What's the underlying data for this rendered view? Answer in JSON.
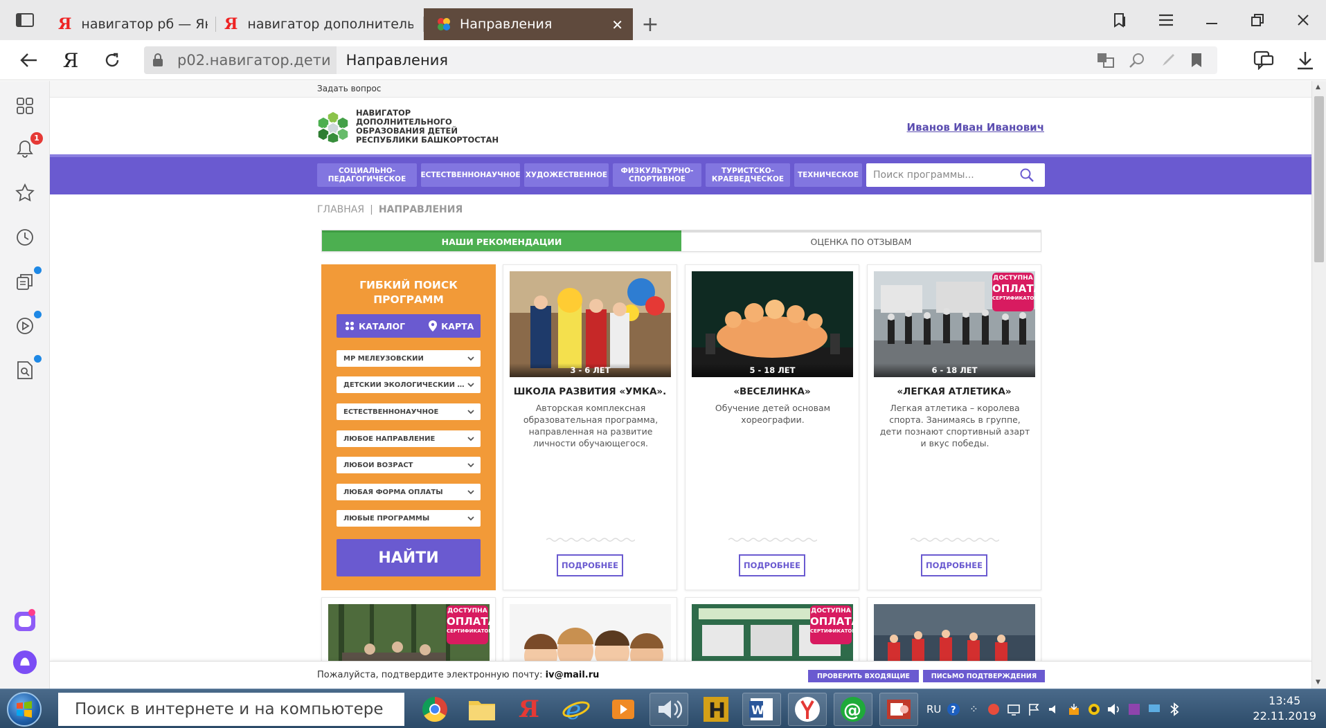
{
  "browser": {
    "tabs": [
      {
        "label": "навигатор рб — Яндекс: на"
      },
      {
        "label": "навигатор дополнительного"
      },
      {
        "label": "Направления"
      }
    ],
    "address": {
      "domain": "p02.навигатор.дети",
      "title": "Направления"
    },
    "sidebar_notification_count": "1"
  },
  "site": {
    "ask_question": "Задать вопрос",
    "logo_text": "НАВИГАТОР ДОПОЛНИТЕЛЬНОГО ОБРАЗОВАНИЯ ДЕТЕЙ РЕСПУБЛИКИ БАШКОРТОСТАН",
    "user_name": "Иванов Иван Иванович",
    "menu": [
      {
        "label": "СОЦИАЛЬНО-ПЕДАГОГИЧЕСКОЕ"
      },
      {
        "label": "ЕСТЕСТВЕННОНАУЧНОЕ"
      },
      {
        "label": "ХУДОЖЕСТВЕННОЕ"
      },
      {
        "label": "ФИЗКУЛЬТУРНО-СПОРТИВНОЕ"
      },
      {
        "label": "ТУРИСТСКО-КРАЕВЕДЧЕСКОЕ"
      },
      {
        "label": "ТЕХНИЧЕСКОЕ"
      }
    ],
    "search_placeholder": "Поиск программы...",
    "breadcrumb": {
      "home": "ГЛАВНАЯ",
      "sep": "|",
      "current": "НАПРАВЛЕНИЯ"
    },
    "rec_tabs": {
      "active": "НАШИ РЕКОМЕНДАЦИИ",
      "inactive": "ОЦЕНКА ПО ОТЗЫВАМ"
    },
    "filter": {
      "title": "ГИБКИЙ ПОИСК ПРОГРАММ",
      "catalog": "КАТАЛОГ",
      "map": "КАРТА",
      "selects": [
        "МР МЕЛЕУЗОВСКИЙ",
        "ДЕТСКИЙ ЭКОЛОГИЧЕСКИЙ ЦЕНТР",
        "ЕСТЕСТВЕННОНАУЧНОЕ",
        "ЛЮБОЕ НАПРАВЛЕНИЕ",
        "ЛЮБОЙ ВОЗРАСТ",
        "ЛЮБАЯ ФОРМА ОПЛАТЫ",
        "ЛЮБЫЕ ПРОГРАММЫ"
      ],
      "find": "НАЙТИ"
    },
    "cert_badge": {
      "line1": "ДОСТУПНА",
      "line2": "ОПЛАТА",
      "line3": "СЕРТИФИКАТОМ"
    },
    "cards": [
      {
        "age": "3 - 6 ЛЕТ",
        "title": "ШКОЛА РАЗВИТИЯ «УМКА».",
        "desc": "Авторская комплексная образовательная программа, направленная на развитие личности обучающегося.",
        "more": "ПОДРОБНЕЕ"
      },
      {
        "age": "5 - 18 ЛЕТ",
        "title": "«ВЕСЕЛИНКА»",
        "desc": "Обучение детей основам хореографии.",
        "more": "ПОДРОБНЕЕ"
      },
      {
        "age": "6 - 18 ЛЕТ",
        "title": "«ЛЕГКАЯ АТЛЕТИКА»",
        "desc": "Легкая атлетика – королева спорта. Занимаясь в группе, дети познают спортивный азарт и вкус победы.",
        "more": "ПОДРОБНЕЕ"
      }
    ],
    "confirm": {
      "message": "Пожалуйста, подтвердите электронную почту:",
      "email": "iv@mail.ru",
      "check_inbox": "ПРОВЕРИТЬ ВХОДЯЩИЕ",
      "resend": "ПИСЬМО ПОДТВЕРЖДЕНИЯ"
    }
  },
  "taskbar": {
    "search_text": "Поиск в интернете и на компьютере",
    "lang": "RU",
    "time": "13:45",
    "date": "22.11.2019"
  },
  "colors": {
    "menu_purple": "#6a5ad0",
    "filter_orange": "#f29a38",
    "tab_green": "#4caf50",
    "cert_pink": "#d81b60",
    "active_tab_brown": "#5f4a3d"
  }
}
